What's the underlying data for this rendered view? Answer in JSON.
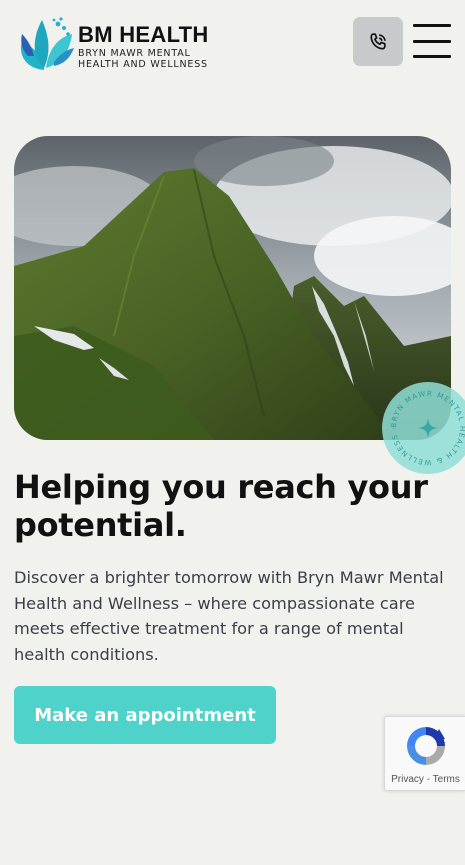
{
  "header": {
    "brand_name": "BM HEALTH",
    "brand_subtitle": "BRYN MAWR MENTAL HEALTH AND WELLNESS",
    "phone_icon": "phone-icon",
    "menu_icon": "hamburger-menu-icon"
  },
  "hero": {
    "badge_text": "BRYN MAWR MENTAL HEALTH & WELLNESS ·",
    "headline": "Helping you reach your potential.",
    "lead": "Discover a brighter tomorrow with Bryn Mawr Mental Health and Wellness – where compassionate care meets effective treatment for a range of mental health conditions.",
    "cta_label": "Make an appointment"
  },
  "recaptcha": {
    "privacy": "Privacy",
    "separator": " - ",
    "terms": "Terms"
  },
  "colors": {
    "accent": "#4fd2c9",
    "background": "#f1f1ee",
    "logo_teal": "#1fb7c9",
    "logo_blue": "#2a5fb4"
  }
}
